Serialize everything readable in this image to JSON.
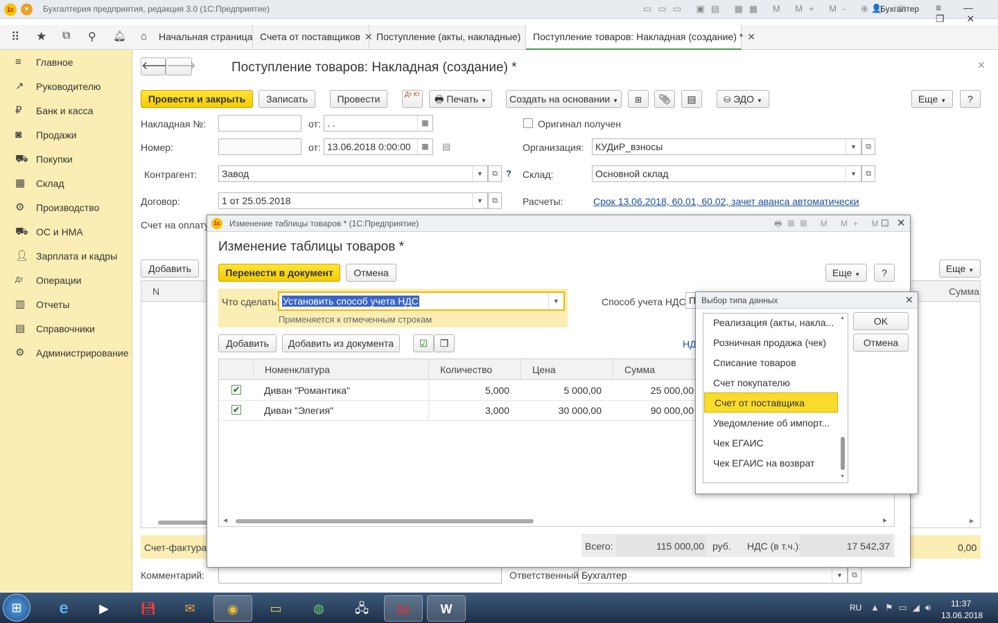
{
  "window": {
    "title": "Бухгалтерия предприятия, редакция 3.0  (1С:Предприятие)",
    "user": "Бухгалтер"
  },
  "tabs": [
    {
      "label": "Начальная страница"
    },
    {
      "label": "Счета от поставщиков"
    },
    {
      "label": "Поступление (акты, накладные)"
    },
    {
      "label": "Поступление товаров: Накладная (создание) *"
    }
  ],
  "sidebar": {
    "items": [
      {
        "label": "Главное",
        "icon": "menu-icon"
      },
      {
        "label": "Руководителю",
        "icon": "trend-icon"
      },
      {
        "label": "Банк и касса",
        "icon": "ruble-icon"
      },
      {
        "label": "Продажи",
        "icon": "bag-icon"
      },
      {
        "label": "Покупки",
        "icon": "cart-icon"
      },
      {
        "label": "Склад",
        "icon": "warehouse-icon"
      },
      {
        "label": "Производство",
        "icon": "factory-icon"
      },
      {
        "label": "ОС и НМА",
        "icon": "truck-icon"
      },
      {
        "label": "Зарплата и кадры",
        "icon": "person-icon"
      },
      {
        "label": "Операции",
        "icon": "dt-kt-icon"
      },
      {
        "label": "Отчеты",
        "icon": "bar-chart-icon"
      },
      {
        "label": "Справочники",
        "icon": "book-icon"
      },
      {
        "label": "Администрирование",
        "icon": "gear-icon"
      }
    ]
  },
  "doc": {
    "title": "Поступление товаров: Накладная (создание) *",
    "btn_post_close": "Провести и закрыть",
    "btn_save": "Записать",
    "btn_post": "Провести",
    "btn_dtkt": "Дт Кт",
    "btn_print": "Печать",
    "btn_create_based": "Создать на основании",
    "btn_edo": "ЭДО",
    "btn_more": "Еще",
    "btn_help": "?",
    "invoice_no_label": "Накладная №:",
    "from_label": "от:",
    "invoice_date": " .  .",
    "original_label": "Оригинал получен",
    "number_label": "Номер:",
    "date_value": "13.06.2018  0:00:00",
    "org_label": "Организация:",
    "org_value": "КУДиР_взносы",
    "counterparty_label": "Контрагент:",
    "counterparty_value": "Завод",
    "warehouse_label": "Склад:",
    "warehouse_value": "Основной склад",
    "contract_label": "Договор:",
    "contract_value": "1 от 25.05.2018",
    "settlements_label": "Расчеты:",
    "settlements_link": "Срок 13.06.2018, 60.01, 60.02, зачет аванса автоматически",
    "payment_invoice_label": "Счет на оплату:",
    "add_button": "Добавить",
    "more2": "Еще",
    "col_n": "N",
    "col_sum": "Сумма",
    "invoice_label": "Счет-фактура N",
    "total_right": "0,00",
    "comment_label": "Комментарий:",
    "responsible_label": "Ответственный:",
    "responsible_value": "Бухгалтер"
  },
  "modal": {
    "window_title": "Изменение таблицы товаров *  (1С:Предприятие)",
    "heading": "Изменение таблицы товаров *",
    "btn_transfer": "Перенести в документ",
    "btn_cancel": "Отмена",
    "btn_more": "Еще",
    "btn_help": "?",
    "action_label": "Что сделать:",
    "action_value": "Установить способ учета НДС",
    "action_hint": "Применяется к отмеченным строкам",
    "vat_label": "Способ учета НДС:",
    "vat_value": "П",
    "btn_add": "Добавить",
    "btn_add_from_doc": "Добавить из документа",
    "nds_link": "НД",
    "columns": [
      "Номенклатура",
      "Количество",
      "Цена",
      "Сумма"
    ],
    "rows": [
      {
        "checked": true,
        "name": "Диван \"Романтика\"",
        "qty": "5,000",
        "price": "5 000,00",
        "sum": "25 000,00"
      },
      {
        "checked": true,
        "name": "Диван \"Элегия\"",
        "qty": "3,000",
        "price": "30 000,00",
        "sum": "90 000,00"
      }
    ],
    "total_label": "Всего:",
    "total_value": "115 000,00",
    "currency": "руб.",
    "vat_total_label": "НДС (в т.ч.):",
    "vat_total_value": "17 542,37"
  },
  "popup": {
    "title": "Выбор типа данных",
    "items": [
      "Реализация (акты, накла...",
      "Розничная продажа (чек)",
      "Списание товаров",
      "Счет покупателю",
      "Счет от поставщика",
      "Уведомление об импорт...",
      "Чек ЕГАИС",
      "Чек ЕГАИС на возврат"
    ],
    "selected_index": 4,
    "ok": "OK",
    "cancel": "Отмена"
  },
  "taskbar": {
    "lang": "RU",
    "time": "11:37",
    "date": "13.06.2018"
  },
  "colors": {
    "accent_yellow": "#f3cb00",
    "sidebar_bg": "#fbeeb4",
    "link": "#1b4ea2"
  }
}
